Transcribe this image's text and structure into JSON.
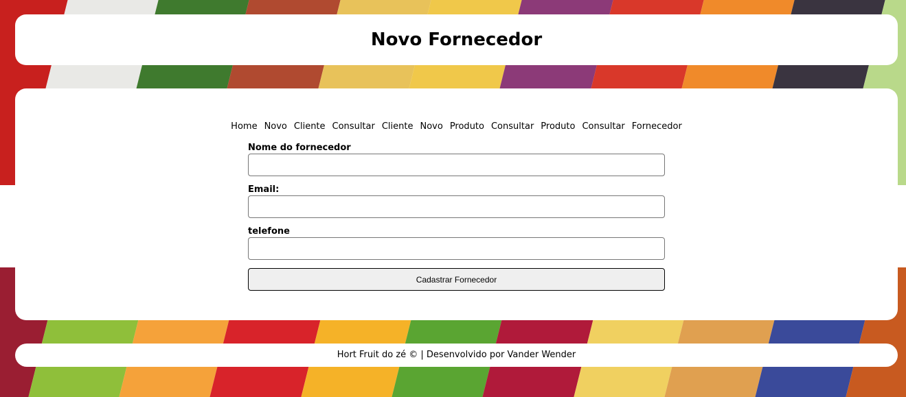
{
  "header": {
    "title": "Novo Fornecedor"
  },
  "nav": {
    "items": [
      "Home",
      "Novo",
      "Cliente",
      "Consultar",
      "Cliente",
      "Novo",
      "Produto",
      "Consultar",
      "Produto",
      "Consultar",
      "Fornecedor"
    ]
  },
  "form": {
    "fields": [
      {
        "label": "Nome do fornecedor",
        "value": "",
        "placeholder": ""
      },
      {
        "label": "Email:",
        "value": "",
        "placeholder": ""
      },
      {
        "label": "telefone",
        "value": "",
        "placeholder": ""
      }
    ],
    "submit_label": "Cadastrar Fornecedor"
  },
  "footer": {
    "text": "Hort Fruit do zé © | Desenvolvido por Vander Wender"
  },
  "colors": {
    "card_background": "#ffffff",
    "button_background": "#efefef",
    "background_stripes_top": [
      "#e8862a",
      "#c8201e",
      "#e9e9e6",
      "#3f7a2e",
      "#b04a30",
      "#e8c25a",
      "#f0c84a",
      "#8c3a78",
      "#d9382a",
      "#f08a2a",
      "#3a3440",
      "#b9d98a",
      "#f7b24a"
    ],
    "background_stripes_bottom": [
      "#d35a2a",
      "#9a1e32",
      "#8fbf3a",
      "#f5a23a",
      "#d8232a",
      "#f5b228",
      "#5aa532",
      "#b01a3a",
      "#f0d060",
      "#e0a050",
      "#3a4a9a",
      "#c85a20",
      "#7a3a82"
    ]
  }
}
